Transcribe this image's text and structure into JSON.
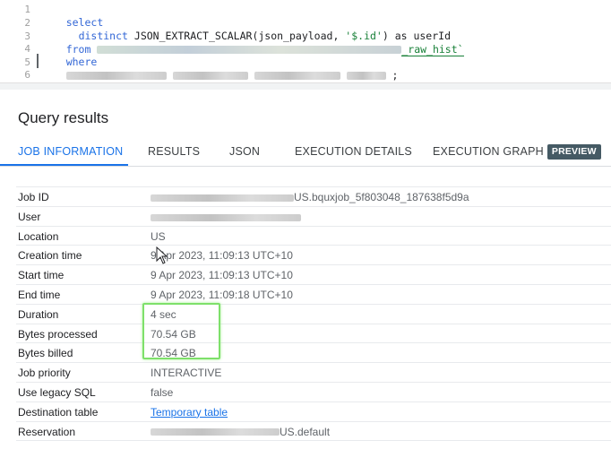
{
  "editor": {
    "line_numbers": [
      "1",
      "2",
      "3",
      "4",
      "5",
      "6"
    ],
    "line1": {
      "kw": "select"
    },
    "line2": {
      "kw": "distinct",
      "fn": "JSON_EXTRACT_SCALAR(json_payload, ",
      "str": "'$.id'",
      "rest": ") as userId"
    },
    "line3": {
      "kw": "from",
      "table_suffix": "_raw_hist`"
    },
    "line4": {
      "kw": "where"
    },
    "line5": {
      "end": ";"
    }
  },
  "results": {
    "title": "Query results"
  },
  "tabs": [
    {
      "label": "JOB INFORMATION"
    },
    {
      "label": "RESULTS"
    },
    {
      "label": "JSON"
    },
    {
      "label": "EXECUTION DETAILS"
    },
    {
      "label": "EXECUTION GRAPH",
      "badge": "PREVIEW"
    }
  ],
  "job_info": {
    "job_id": {
      "label": "Job ID",
      "value": "US.bquxjob_5f803048_187638f5d9a"
    },
    "user": {
      "label": "User",
      "value": ""
    },
    "location": {
      "label": "Location",
      "value": "US"
    },
    "creation_time": {
      "label": "Creation time",
      "value": "9 Apr 2023, 11:09:13 UTC+10"
    },
    "start_time": {
      "label": "Start time",
      "value": "9 Apr 2023, 11:09:13 UTC+10"
    },
    "end_time": {
      "label": "End time",
      "value": "9 Apr 2023, 11:09:18 UTC+10"
    },
    "duration": {
      "label": "Duration",
      "value": "4 sec"
    },
    "bytes_processed": {
      "label": "Bytes processed",
      "value": "70.54 GB"
    },
    "bytes_billed": {
      "label": "Bytes billed",
      "value": "70.54 GB"
    },
    "job_priority": {
      "label": "Job priority",
      "value": "INTERACTIVE"
    },
    "legacy_sql": {
      "label": "Use legacy SQL",
      "value": "false"
    },
    "destination_table": {
      "label": "Destination table",
      "value": "Temporary table"
    },
    "reservation": {
      "label": "Reservation",
      "value": "US.default"
    }
  },
  "colors": {
    "accent": "#1a73e8",
    "highlight": "#7ee06a",
    "badge": "#455a64"
  }
}
